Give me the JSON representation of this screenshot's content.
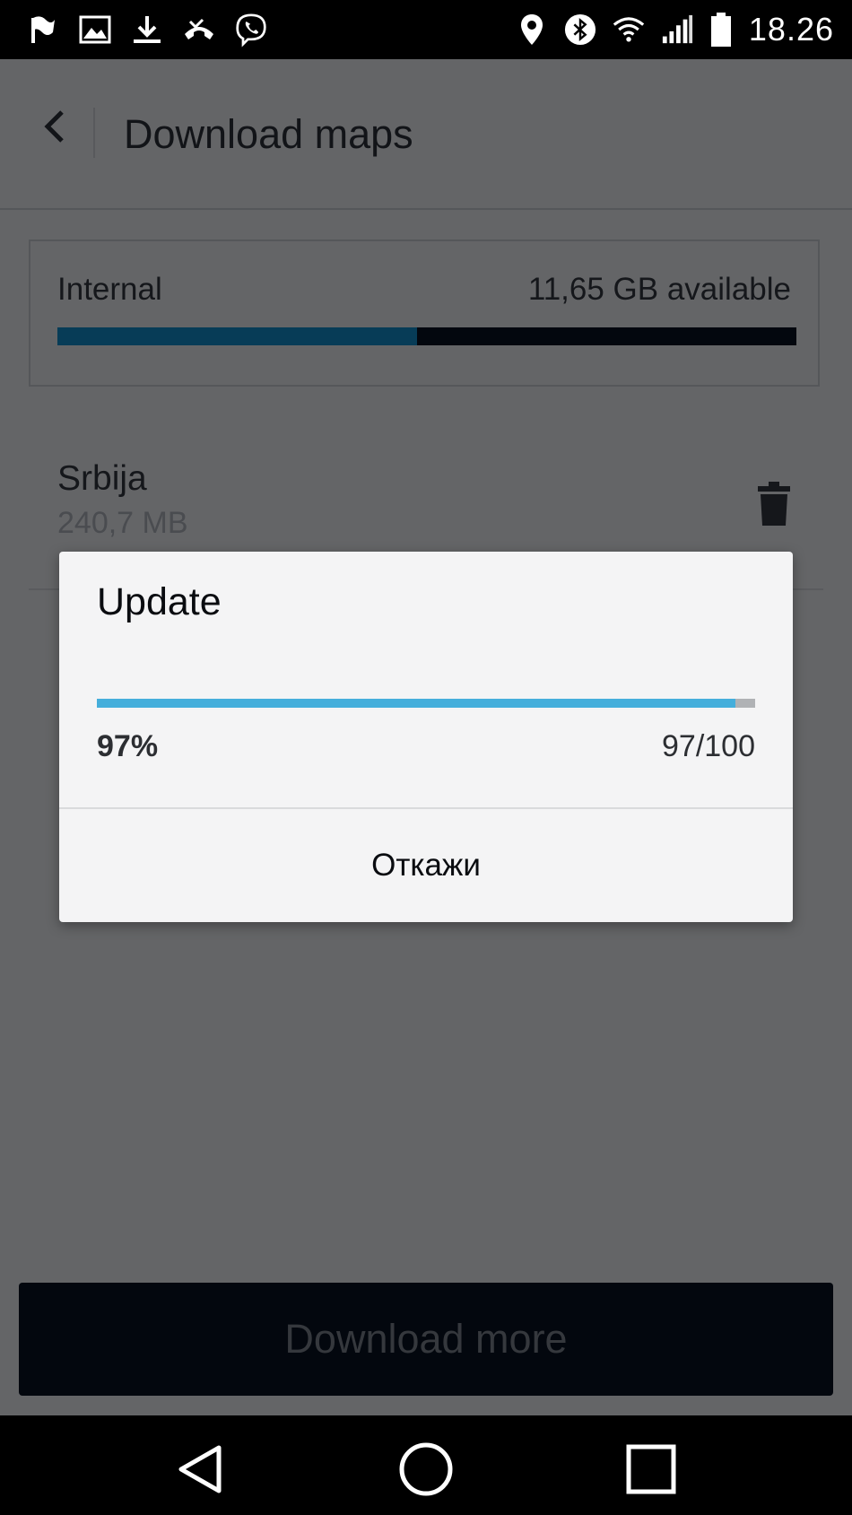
{
  "status_bar": {
    "time": "18.26",
    "left_icons": [
      "flag-icon",
      "image-icon",
      "download-icon",
      "missed-call-icon",
      "viber-icon"
    ],
    "right_icons": [
      "location-icon",
      "bluetooth-icon",
      "wifi-icon",
      "signal-icon",
      "battery-icon"
    ]
  },
  "toolbar": {
    "title": "Download maps"
  },
  "storage": {
    "label": "Internal",
    "available": "11,65 GB available",
    "used_fraction": 0.487
  },
  "maps": [
    {
      "name": "Srbija",
      "size": "240,7 MB"
    }
  ],
  "download_more_label": "Download more",
  "dialog": {
    "title": "Update",
    "progress_fraction": 0.97,
    "percent_text": "97%",
    "count_text": "97/100",
    "cancel_label": "Откажи"
  },
  "colors": {
    "accent": "#45aedb",
    "storage_fill": "#073c57",
    "dim_background": "#646567"
  }
}
